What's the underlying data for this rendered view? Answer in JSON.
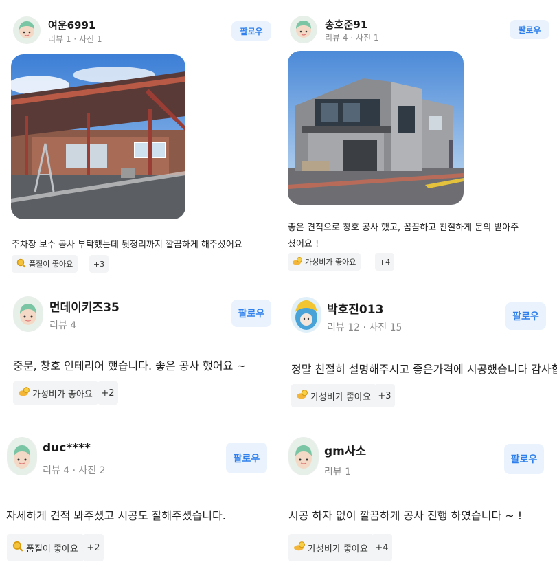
{
  "reviews": [
    {
      "user": "여운6991",
      "meta": "리뷰 1 · 사진 1",
      "follow": "팔로우",
      "text": "주차장 보수 공사 부탁했는데 뒷정리까지 깔끔하게 해주셨어요",
      "tag": "품질이 좋아요",
      "tag_icon": "magnifier-icon",
      "more": "+3"
    },
    {
      "user": "송호준91",
      "meta": "리뷰 4 · 사진 1",
      "follow": "팔로우",
      "text_line1": "좋은 견적으로 창호 공사 했고, 꼼꼼하고 친절하게 문의 받아주",
      "text_line2": "셨어요 !",
      "tag": "가성비가 좋아요",
      "tag_icon": "coin-hand-icon",
      "more": "+4"
    },
    {
      "user": "먼데이키즈35",
      "meta": "리뷰 4",
      "follow": "팔로우",
      "text": "중문, 창호 인테리어 했습니다. 좋은 공사 했어요 ~",
      "tag": "가성비가 좋아요",
      "tag_icon": "coin-hand-icon",
      "more": "+2"
    },
    {
      "user": "박호진013",
      "meta": "리뷰 12 · 사진 15",
      "follow": "팔로우",
      "text": "정말 친절히 설명해주시고 좋은가격에 시공했습니다 감사합니다",
      "tag": "가성비가 좋아요",
      "tag_icon": "coin-hand-icon",
      "more": "+3"
    },
    {
      "user": "duc****",
      "meta": "리뷰 4 · 사진 2",
      "follow": "팔로우",
      "text": "자세하게 견적 봐주셨고 시공도 잘해주셨습니다.",
      "tag": "품질이 좋아요",
      "tag_icon": "magnifier-icon",
      "more": "+2"
    },
    {
      "user": "gm사소",
      "meta": "리뷰 1",
      "follow": "팔로우",
      "text": "시공 하자 없이 깔끔하게 공사 진행 하였습니다 ~ !",
      "tag": "가성비가 좋아요",
      "tag_icon": "coin-hand-icon",
      "more": "+4"
    }
  ],
  "colors": {
    "follow_bg": "#eaf3fd",
    "follow_text": "#2f80ed",
    "tag_bg": "#f3f4f5",
    "meta_text": "#8a8a8a"
  }
}
